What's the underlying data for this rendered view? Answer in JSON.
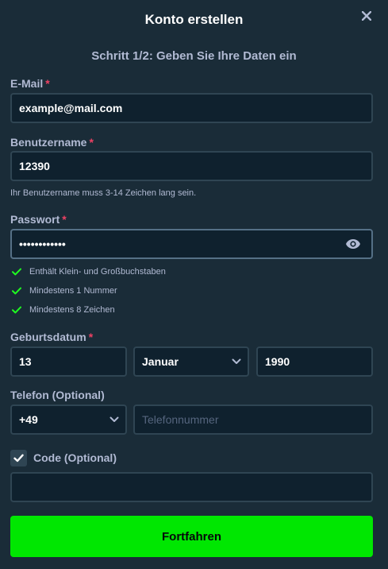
{
  "modal": {
    "title": "Konto erstellen",
    "step": "Schritt 1/2: Geben Sie Ihre Daten ein"
  },
  "email": {
    "label": "E-Mail",
    "required_mark": "*",
    "value": "example@mail.com"
  },
  "username": {
    "label": "Benutzername",
    "required_mark": "*",
    "value": "12390",
    "hint": "Ihr Benutzername muss 3-14 Zeichen lang sein."
  },
  "password": {
    "label": "Passwort",
    "required_mark": "*",
    "value": "Password123!",
    "rules": [
      {
        "text": "Enthält Klein- und Großbuchstaben",
        "met": true
      },
      {
        "text": "Mindestens 1 Nummer",
        "met": true
      },
      {
        "text": "Mindestens 8 Zeichen",
        "met": true
      }
    ]
  },
  "birthdate": {
    "label": "Geburtsdatum",
    "required_mark": "*",
    "day": "13",
    "month": "Januar",
    "year": "1990"
  },
  "phone": {
    "label": "Telefon (Optional)",
    "country_code": "+49",
    "placeholder": "Telefonnummer"
  },
  "code": {
    "label": "Code (Optional)",
    "checked": true,
    "value": ""
  },
  "continue_button": {
    "label": "Fortfahren"
  },
  "icons": {
    "close": "close-icon",
    "eye": "eye-icon",
    "check": "check-icon",
    "chevron": "chevron-down-icon"
  },
  "colors": {
    "background": "#1a2c38",
    "input_background": "#0f212e",
    "input_border": "#2f4553",
    "label": "#b1bad3",
    "required": "#ed4163",
    "check": "#1fff20",
    "primary_button": "#00e701"
  }
}
